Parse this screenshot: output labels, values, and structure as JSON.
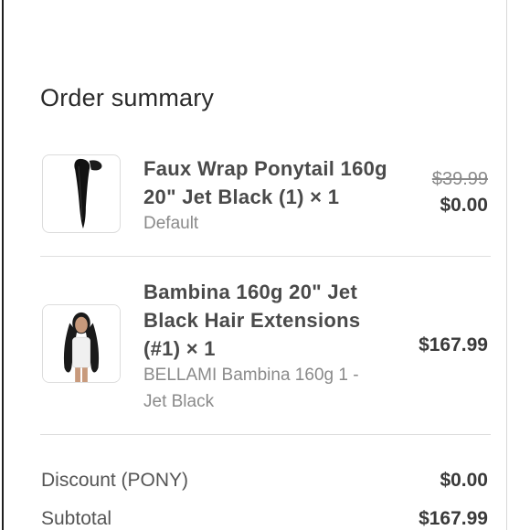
{
  "order": {
    "title": "Order summary",
    "items": [
      {
        "name_line1": "Faux Wrap Ponytail 160g",
        "name_line2": "20\" Jet Black (1) × 1",
        "variant": "Default",
        "original_price": "$39.99",
        "price": "$0.00",
        "thumbnail": "ponytail-image"
      },
      {
        "name_line1": "Bambina 160g 20\" Jet",
        "name_line2": "Black Hair Extensions",
        "name_line3": "(#1) × 1",
        "variant_line1": "BELLAMI Bambina 160g 1 -",
        "variant_line2": "Jet Black",
        "price": "$167.99",
        "thumbnail": "model-image"
      }
    ],
    "summary": {
      "discount_label": "Discount (PONY)",
      "discount_value": "$0.00",
      "subtotal_label": "Subtotal",
      "subtotal_value": "$167.99"
    }
  }
}
